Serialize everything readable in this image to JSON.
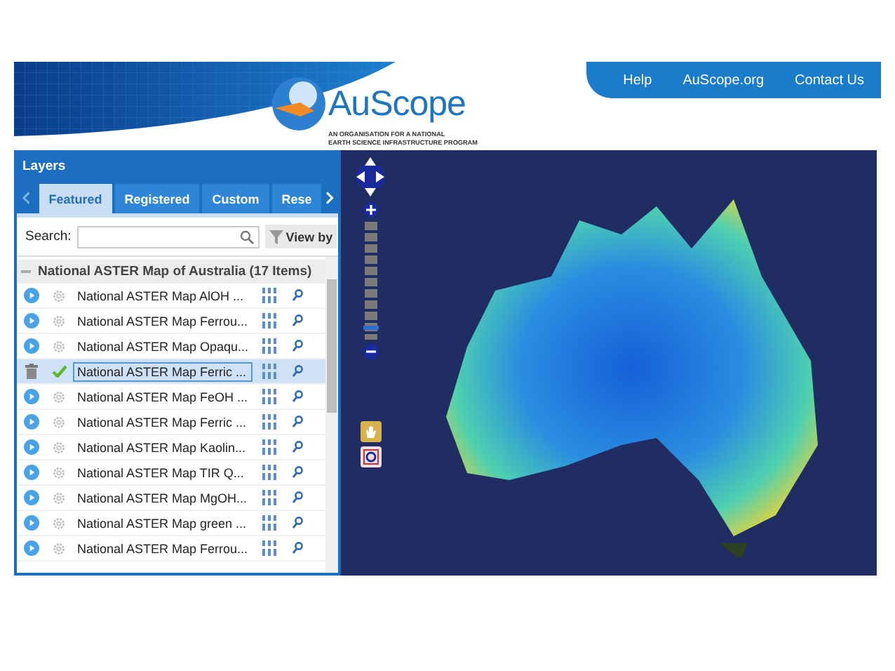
{
  "header": {
    "logo": {
      "name": "AuScope",
      "tagline": [
        "AN ORGANISATION FOR A NATIONAL",
        "EARTH SCIENCE INFRASTRUCTURE PROGRAM"
      ]
    },
    "nav": [
      "Help",
      "AuScope.org",
      "Contact Us"
    ]
  },
  "panel": {
    "title": "Layers",
    "tabs": [
      {
        "label": "Featured",
        "selected": true
      },
      {
        "label": "Registered",
        "selected": false
      },
      {
        "label": "Custom",
        "selected": false
      },
      {
        "label": "Rese",
        "selected": false
      }
    ],
    "search": {
      "label": "Search:",
      "view_by": "View by"
    },
    "group": {
      "title": "National ASTER Map of Australia (17 Items)",
      "expanded": true
    },
    "layers": [
      {
        "name": "National ASTER Map AlOH ...",
        "loaded": false,
        "selected": false
      },
      {
        "name": "National ASTER Map Ferrou...",
        "loaded": false,
        "selected": false
      },
      {
        "name": "National ASTER Map Opaqu...",
        "loaded": false,
        "selected": false
      },
      {
        "name": "National ASTER Map Ferric ...",
        "loaded": true,
        "selected": true
      },
      {
        "name": "National ASTER Map FeOH ...",
        "loaded": false,
        "selected": false
      },
      {
        "name": "National ASTER Map Ferric ...",
        "loaded": false,
        "selected": false
      },
      {
        "name": "National ASTER Map Kaolin...",
        "loaded": false,
        "selected": false
      },
      {
        "name": "National ASTER Map TIR Q...",
        "loaded": false,
        "selected": false
      },
      {
        "name": "National ASTER Map MgOH...",
        "loaded": false,
        "selected": false
      },
      {
        "name": "National ASTER Map green ...",
        "loaded": false,
        "selected": false
      },
      {
        "name": "National ASTER Map Ferrou...",
        "loaded": false,
        "selected": false
      }
    ]
  },
  "map": {
    "zoom": {
      "level": 0.08
    }
  }
}
